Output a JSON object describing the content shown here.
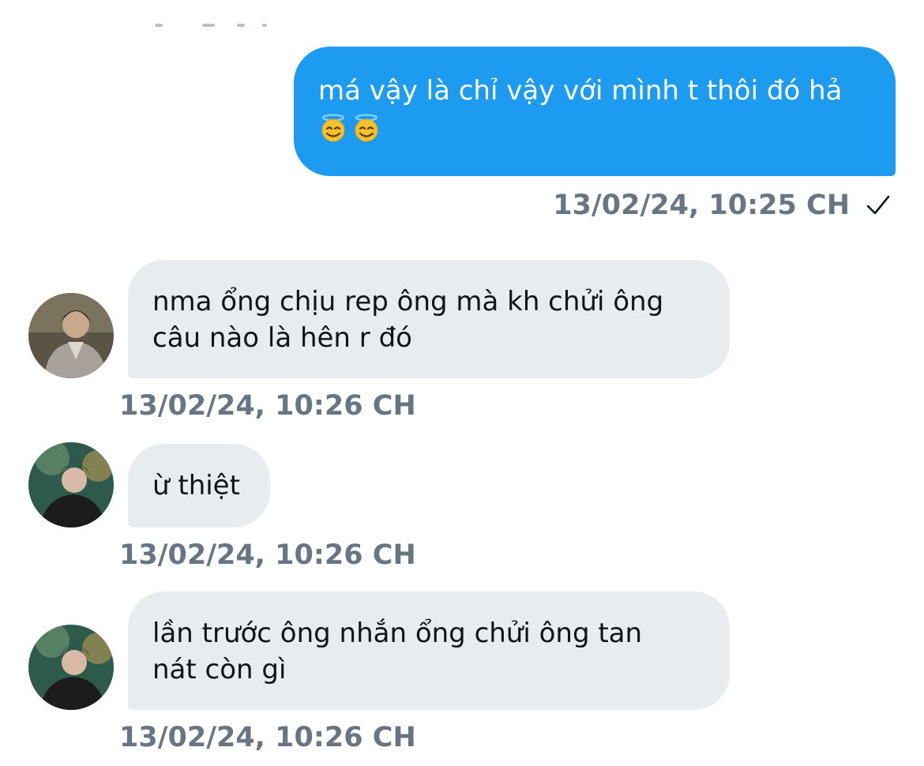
{
  "messages": [
    {
      "direction": "sent",
      "text": "má vậy là chỉ vậy với mình t thôi đó hả",
      "emojis": [
        "smiling-face-with-halo",
        "smiling-face-with-halo"
      ],
      "timestamp": "13/02/24, 10:25 CH",
      "status_icon": "check-icon"
    },
    {
      "direction": "received",
      "text_lines": [
        "nma ổng chịu rep ông mà kh chửi ông",
        "câu nào là hên r đó"
      ],
      "timestamp": "13/02/24, 10:26 CH",
      "avatar": "avatar-photo"
    },
    {
      "direction": "received",
      "text_lines": [
        "ừ thiệt"
      ],
      "timestamp": "13/02/24, 10:26 CH",
      "avatar": "avatar-photo"
    },
    {
      "direction": "received",
      "text_lines": [
        "lần trước ông nhắn ổng chửi ông tan",
        "nát còn gì"
      ],
      "timestamp": "13/02/24, 10:26 CH",
      "avatar": "avatar-photo"
    }
  ],
  "colors": {
    "sent_bubble": "#1d9bf0",
    "received_bubble": "#e8ecef",
    "timestamp": "#687684",
    "text_dark": "#0f1419"
  }
}
